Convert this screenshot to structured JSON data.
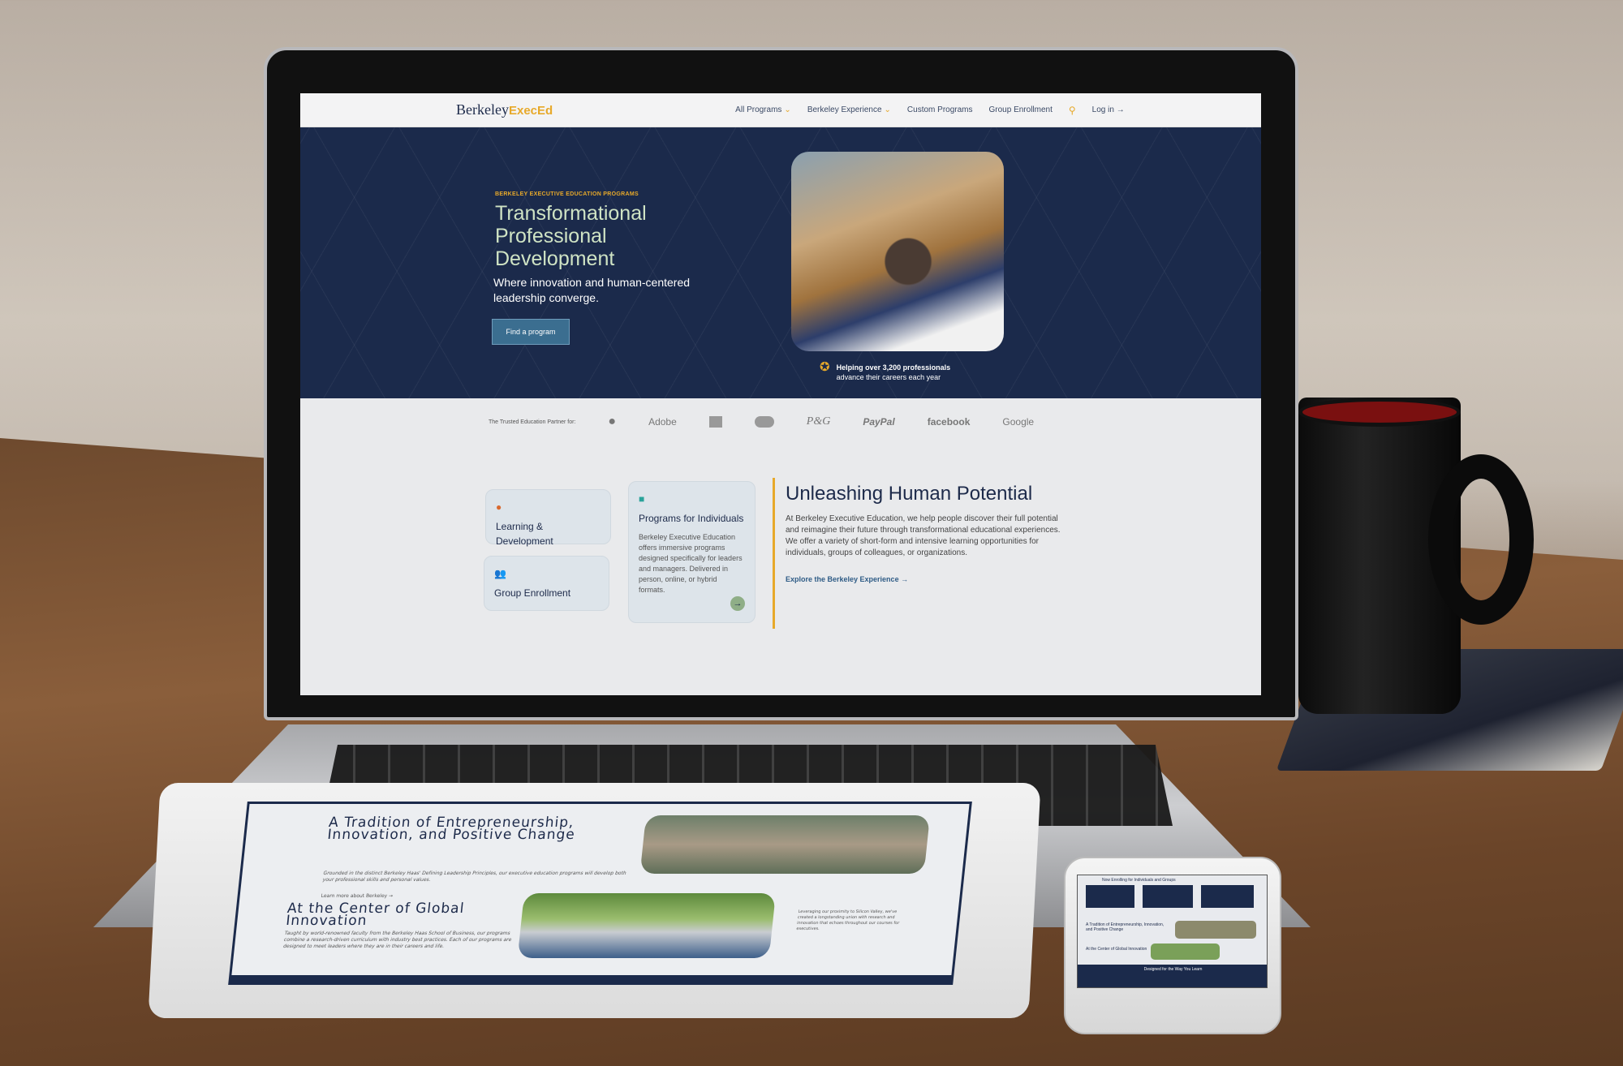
{
  "laptop": {
    "logo": {
      "part1": "Berkeley",
      "part2": "ExecEd"
    },
    "nav": [
      {
        "label": "All Programs",
        "dropdown": true
      },
      {
        "label": "Berkeley Experience",
        "dropdown": true
      },
      {
        "label": "Custom Programs"
      },
      {
        "label": "Group Enrollment"
      },
      {
        "label": "Log in →"
      }
    ],
    "hero": {
      "eyebrow": "BERKELEY EXECUTIVE EDUCATION PROGRAMS",
      "title": "Transformational Professional Development",
      "subtitle": "Where innovation and human-centered leadership converge.",
      "button": "Find a program",
      "award_line1": "Helping over 3,200 professionals",
      "award_line2": "advance their careers each year"
    },
    "partners": {
      "label": "The Trusted Education Partner for:",
      "logos": [
        "",
        "Adobe",
        "",
        "",
        "P&G",
        "PayPal",
        "facebook",
        "Google"
      ]
    },
    "cards": [
      {
        "title": "Learning & Development",
        "icon": "person-icon"
      },
      {
        "title": "Group Enrollment",
        "icon": "group-icon"
      },
      {
        "title": "Programs for Individuals",
        "icon": "briefcase-icon",
        "description": "Berkeley Executive Education offers immersive programs designed specifically for leaders and managers. Delivered in person, online, or hybrid formats."
      }
    ],
    "about": {
      "title": "Unleashing Human Potential",
      "body": "At Berkeley Executive Education, we help people discover their full potential and reimagine their future through transformational educational experiences. We offer a variety of short-form and intensive learning opportunities for individuals, groups of colleagues, or organizations.",
      "link": "Explore the Berkeley Experience →"
    }
  },
  "tablet": {
    "tradition_title": "A Tradition of Entrepreneurship, Innovation, and Positive Change",
    "tradition_body": "Grounded in the distinct Berkeley Haas' Defining Leadership Principles, our executive education programs will develop both your professional skills and personal values.",
    "tradition_link": "Learn more about Berkeley →",
    "center_title": "At the Center of Global Innovation",
    "center_body": "Taught by world-renowned faculty from the Berkeley Haas School of Business, our programs combine a research-driven curriculum with industry best practices. Each of our programs are designed to meet leaders where they are in their careers and life.",
    "side_note": "Leveraging our proximity to Silicon Valley, we've created a longstanding union with research and innovation that echoes throughout our courses for executives."
  },
  "phone": {
    "heading1": "Now Enrolling for Individuals and Groups",
    "heading2": "A Tradition of Entrepreneurship, Innovation, and Positive Change",
    "heading3": "At the Center of Global Innovation",
    "heading4": "Designed for the Way You Learn"
  },
  "colors": {
    "navy": "#1b2a4b",
    "gold": "#e7a92a",
    "button": "#3b6e90",
    "mint": "#cfe3c4"
  }
}
